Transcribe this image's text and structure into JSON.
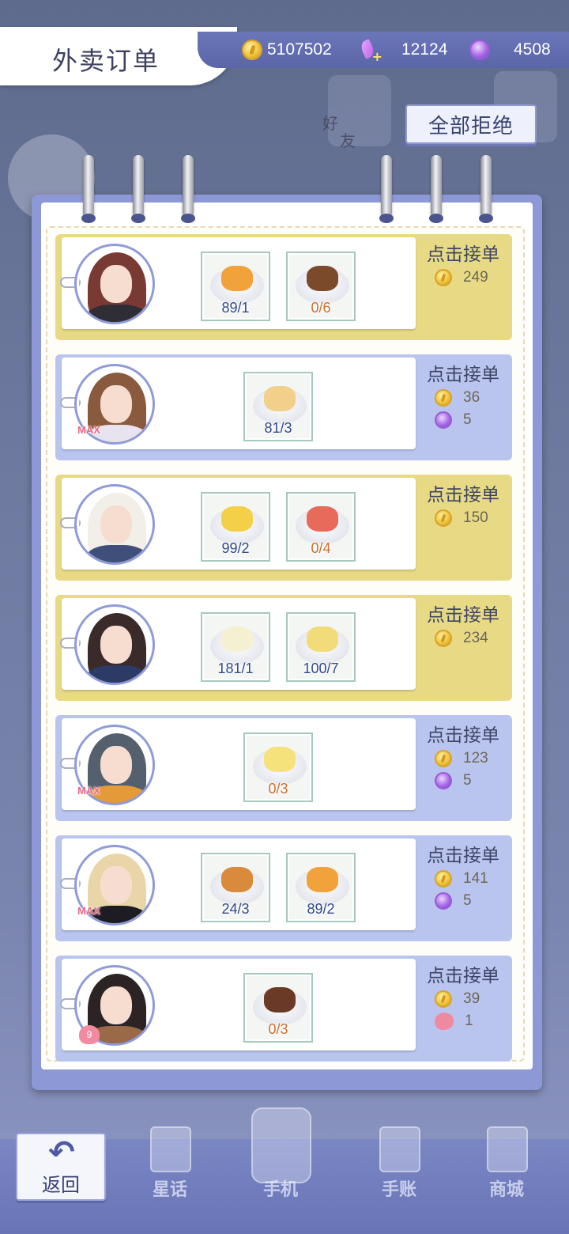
{
  "header": {
    "title": "外卖订单",
    "gold": "5107502",
    "stamina": "12124",
    "gems": "4508",
    "reject_all": "全部拒绝"
  },
  "background": {
    "friend_label_1": "好",
    "friend_label_2": "友"
  },
  "orders": [
    {
      "style": "yellow",
      "max": false,
      "badge": "",
      "dishes": [
        {
          "icon": "orange-pudding-icon",
          "qty": "89/1",
          "lack": false
        },
        {
          "icon": "chocolate-parfait-icon",
          "qty": "0/6",
          "lack": true
        }
      ],
      "accept": "点击接单",
      "rewards": [
        {
          "type": "coin",
          "value": "249"
        }
      ]
    },
    {
      "style": "blue",
      "max": true,
      "badge": "MAX",
      "dishes": [
        {
          "icon": "cheesecake-slice-icon",
          "qty": "81/3",
          "lack": false
        }
      ],
      "accept": "点击接单",
      "rewards": [
        {
          "type": "coin",
          "value": "36"
        },
        {
          "type": "gem",
          "value": "5"
        }
      ]
    },
    {
      "style": "yellow",
      "max": false,
      "badge": "",
      "dishes": [
        {
          "icon": "butter-cake-icon",
          "qty": "99/2",
          "lack": false
        },
        {
          "icon": "strawberry-roll-icon",
          "qty": "0/4",
          "lack": true
        }
      ],
      "accept": "点击接单",
      "rewards": [
        {
          "type": "coin",
          "value": "150"
        }
      ]
    },
    {
      "style": "yellow",
      "max": false,
      "badge": "",
      "dishes": [
        {
          "icon": "egg-salad-icon",
          "qty": "181/1",
          "lack": false
        },
        {
          "icon": "mashed-potato-icon",
          "qty": "100/7",
          "lack": false
        }
      ],
      "accept": "点击接单",
      "rewards": [
        {
          "type": "coin",
          "value": "234"
        }
      ]
    },
    {
      "style": "blue",
      "max": true,
      "badge": "MAX",
      "dishes": [
        {
          "icon": "lemon-juice-icon",
          "qty": "0/3",
          "lack": true
        }
      ],
      "accept": "点击接单",
      "rewards": [
        {
          "type": "coin",
          "value": "123"
        },
        {
          "type": "gem",
          "value": "5"
        }
      ]
    },
    {
      "style": "blue",
      "max": true,
      "badge": "MAX",
      "dishes": [
        {
          "icon": "hamburger-icon",
          "qty": "24/3",
          "lack": false
        },
        {
          "icon": "orange-pudding-icon",
          "qty": "89/2",
          "lack": false
        }
      ],
      "accept": "点击接单",
      "rewards": [
        {
          "type": "coin",
          "value": "141"
        },
        {
          "type": "gem",
          "value": "5"
        }
      ]
    },
    {
      "style": "blue",
      "max": false,
      "badge": "9",
      "dishes": [
        {
          "icon": "latte-art-coffee-icon",
          "qty": "0/3",
          "lack": true
        }
      ],
      "accept": "点击接单",
      "rewards": [
        {
          "type": "coin",
          "value": "39"
        },
        {
          "type": "heart",
          "value": "1"
        }
      ]
    }
  ],
  "nav": {
    "back": "返回",
    "items": [
      {
        "label": "星话"
      },
      {
        "label": "手机"
      },
      {
        "label": "手账"
      },
      {
        "label": "商城"
      }
    ]
  },
  "colors": {
    "yellow_order": "#e8da84",
    "blue_order": "#b9c5ee",
    "accent": "#6b76b8"
  }
}
